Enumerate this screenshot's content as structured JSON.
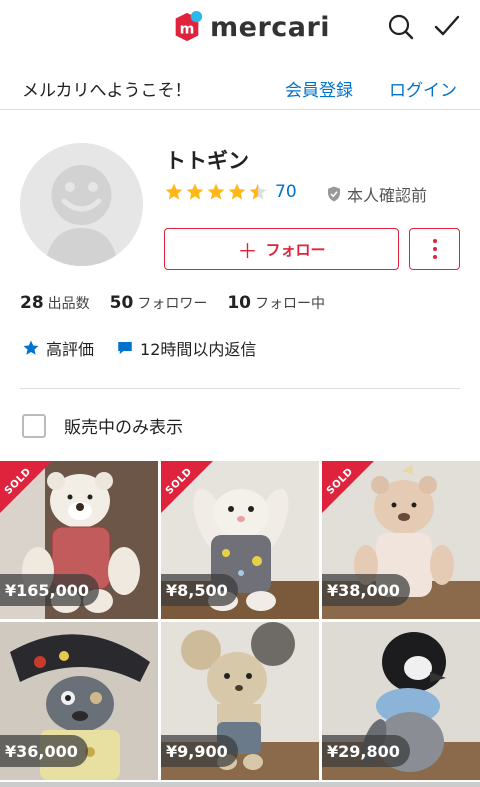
{
  "header": {
    "brand": "mercari",
    "brand_color": "#e0233d",
    "search_icon": "search-icon",
    "todo_icon": "check-icon"
  },
  "welcome": {
    "text": "メルカリへようこそ！",
    "register_label": "会員登録",
    "login_label": "ログイン"
  },
  "profile": {
    "name": "トトギン",
    "rating_stars": 4.5,
    "rating_count": "70",
    "verification": "本人確認前",
    "follow_label": "フォロー",
    "stats": [
      {
        "value": "28",
        "label": "出品数"
      },
      {
        "value": "50",
        "label": "フォロワー"
      },
      {
        "value": "10",
        "label": "フォロー中"
      }
    ],
    "badges": [
      {
        "icon": "star-icon",
        "label": "高評価"
      },
      {
        "icon": "chat-bubble-icon",
        "label": "12時間以内返信"
      }
    ]
  },
  "filter": {
    "label": "販売中のみ表示",
    "checked": false
  },
  "items": [
    {
      "price": "¥165,000",
      "sold": true,
      "sold_label": "SOLD"
    },
    {
      "price": "¥8,500",
      "sold": true,
      "sold_label": "SOLD"
    },
    {
      "price": "¥38,000",
      "sold": true,
      "sold_label": "SOLD"
    },
    {
      "price": "¥36,000",
      "sold": false
    },
    {
      "price": "¥9,900",
      "sold": false
    },
    {
      "price": "¥29,800",
      "sold": false
    }
  ],
  "colors": {
    "accent_red": "#e0233d",
    "link_blue": "#0073cc",
    "star_yellow": "#ffb818"
  }
}
